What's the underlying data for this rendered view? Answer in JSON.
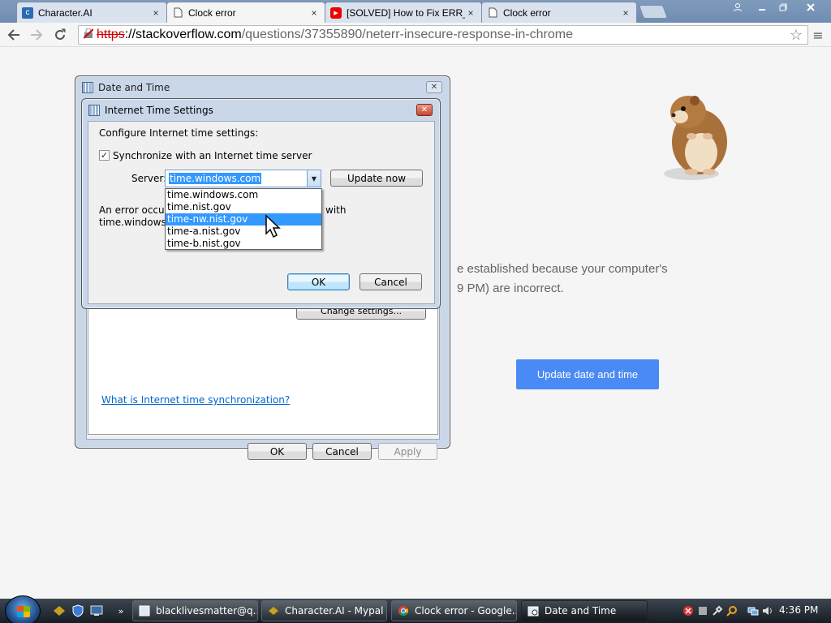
{
  "browser": {
    "tabs": [
      {
        "title": "Character.AI",
        "favicon": "character-ai-icon",
        "active": false
      },
      {
        "title": "Clock error",
        "favicon": "page-icon",
        "active": true
      },
      {
        "title": "[SOLVED] How to Fix ERR_",
        "favicon": "youtube-icon",
        "active": false
      },
      {
        "title": "Clock error",
        "favicon": "page-icon",
        "active": false
      }
    ],
    "tab_close_glyph": "×",
    "address": {
      "scheme": "https",
      "host": "://stackoverflow.com",
      "path": "/questions/37355890/neterr-insecure-response-in-chrome"
    }
  },
  "page": {
    "message_line1": "e established because your computer's",
    "message_line2": "9 PM) are incorrect.",
    "update_button": "Update date and time"
  },
  "date_time_dialog": {
    "title": "Date and Time",
    "change_settings": "Change settings...",
    "help_link": "What is Internet time synchronization?",
    "ok": "OK",
    "cancel": "Cancel",
    "apply": "Apply"
  },
  "internet_time_dialog": {
    "title": "Internet Time Settings",
    "heading": "Configure Internet time settings:",
    "sync_checkbox_label": "Synchronize with an Internet time server",
    "sync_checked": true,
    "server_label": "Server:",
    "server_value": "time.windows.com",
    "update_now": "Update now",
    "error_left_line1": "An error occurr",
    "error_left_line2": "time.windows.c",
    "error_right": "with",
    "options": [
      "time.windows.com",
      "time.nist.gov",
      "time-nw.nist.gov",
      "time-a.nist.gov",
      "time-b.nist.gov"
    ],
    "highlighted_option": "time-nw.nist.gov",
    "ok": "OK",
    "cancel": "Cancel"
  },
  "taskbar": {
    "buttons": [
      {
        "label": "blacklivesmatter@q...",
        "icon": "window-icon"
      },
      {
        "label": "Character.AI - Mypal",
        "icon": "mypal-icon"
      },
      {
        "label": "Clock error - Google...",
        "icon": "chrome-icon"
      },
      {
        "label": "Date and Time",
        "icon": "clock-icon",
        "active": true
      }
    ],
    "clock": "4:36 PM"
  },
  "colors": {
    "accent_blue": "#4a8af4",
    "selection": "#3399ff",
    "omnibox_error": "#cc0000"
  }
}
